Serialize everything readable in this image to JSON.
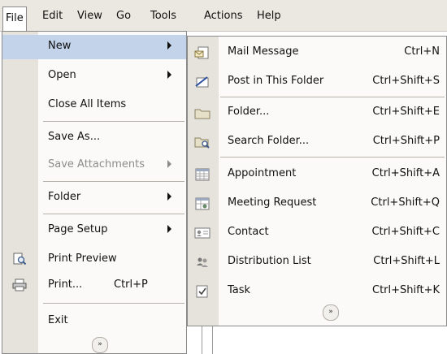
{
  "menubar": {
    "items": [
      {
        "label": "File",
        "accel_char": "F"
      },
      {
        "label": "Edit",
        "accel_char": "E"
      },
      {
        "label": "View",
        "accel_char": "V"
      },
      {
        "label": "Go",
        "accel_char": "G"
      },
      {
        "label": "Tools",
        "accel_char": "T"
      },
      {
        "label": "Actions",
        "accel_char": "A"
      },
      {
        "label": "Help",
        "accel_char": "H"
      }
    ]
  },
  "file_menu": {
    "items": [
      {
        "label": "New",
        "has_submenu": true
      },
      {
        "label": "Open",
        "has_submenu": true
      },
      {
        "label": "Close All Items"
      },
      {
        "label": "Save As..."
      },
      {
        "label": "Save Attachments",
        "has_submenu": true,
        "disabled": true
      },
      {
        "label": "Folder",
        "has_submenu": true
      },
      {
        "label": "Page Setup",
        "has_submenu": true
      },
      {
        "label": "Print Preview",
        "icon": "print-preview-icon"
      },
      {
        "label": "Print...",
        "shortcut": "Ctrl+P",
        "icon": "printer-icon"
      },
      {
        "label": "Exit"
      }
    ],
    "expand_glyph": "»"
  },
  "new_submenu": {
    "items": [
      {
        "label": "Mail Message",
        "shortcut": "Ctrl+N",
        "icon": "mail-message-icon"
      },
      {
        "label": "Post in This Folder",
        "shortcut": "Ctrl+Shift+S",
        "icon": "post-icon"
      },
      {
        "label": "Folder...",
        "shortcut": "Ctrl+Shift+E",
        "icon": "folder-icon"
      },
      {
        "label": "Search Folder...",
        "shortcut": "Ctrl+Shift+P",
        "icon": "search-folder-icon"
      },
      {
        "label": "Appointment",
        "shortcut": "Ctrl+Shift+A",
        "icon": "appointment-icon"
      },
      {
        "label": "Meeting Request",
        "shortcut": "Ctrl+Shift+Q",
        "icon": "meeting-request-icon"
      },
      {
        "label": "Contact",
        "shortcut": "Ctrl+Shift+C",
        "icon": "contact-icon"
      },
      {
        "label": "Distribution List",
        "shortcut": "Ctrl+Shift+L",
        "icon": "distribution-list-icon"
      },
      {
        "label": "Task",
        "shortcut": "Ctrl+Shift+K",
        "icon": "task-icon"
      }
    ],
    "expand_glyph": "»"
  }
}
